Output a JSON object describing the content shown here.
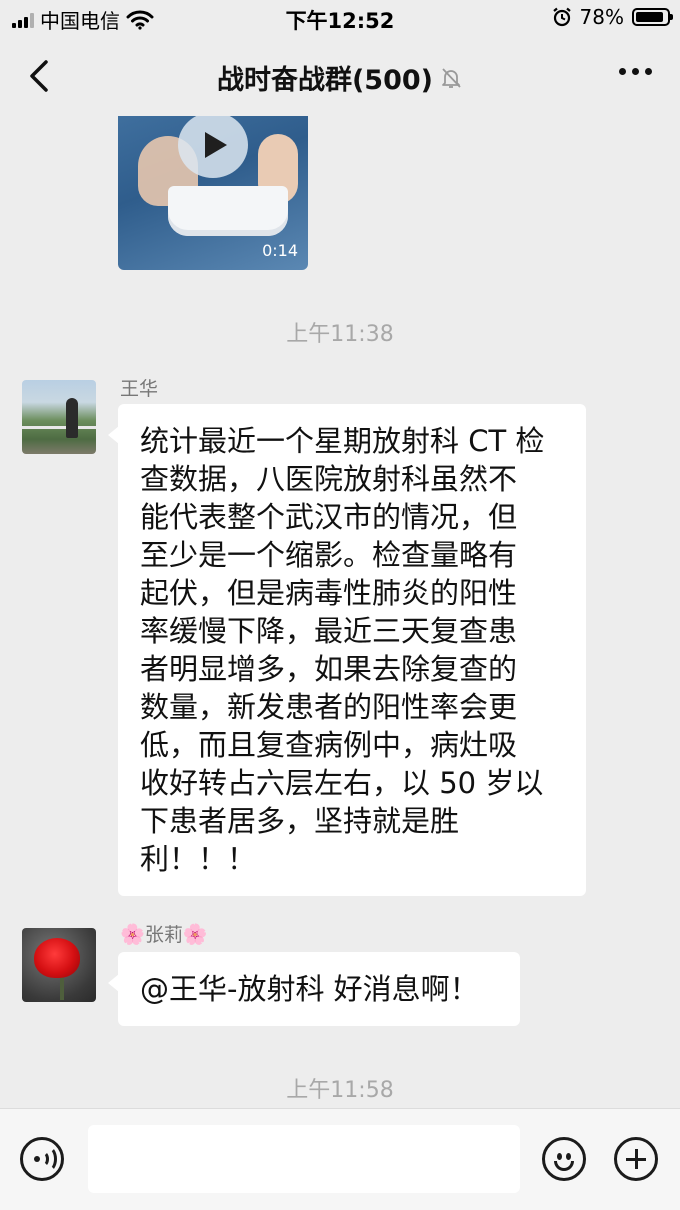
{
  "status_bar": {
    "carrier": "中国电信",
    "time": "下午12:52",
    "battery_percent": "78%",
    "icons": [
      "signal-icon",
      "wifi-icon",
      "alarm-icon",
      "battery-icon"
    ]
  },
  "nav": {
    "title": "战时奋战群(500)",
    "icons": [
      "back-icon",
      "mute-bell-icon",
      "more-icon"
    ]
  },
  "messages": {
    "video": {
      "duration": "0:14",
      "icon": "play-icon"
    },
    "time_1": "上午11:38",
    "msg_1": {
      "sender": "王华",
      "lines": [
        "统计最近一个星期放射科 CT 检",
        "查数据，八医院放射科虽然不",
        "能代表整个武汉市的情况，但",
        "至少是一个缩影。检查量略有",
        "起伏，但是病毒性肺炎的阳性",
        "率缓慢下降，最近三天复查患",
        "者明显增多，如果去除复查的",
        "数量，新发患者的阳性率会更",
        "低，而且复查病例中，病灶吸",
        "收好转占六层左右，以 50 岁以",
        "下患者居多，坚持就是胜",
        "利！！！"
      ]
    },
    "msg_2": {
      "sender_prefix": "🌸",
      "sender": "张莉",
      "sender_suffix": "🌸",
      "text": "@王华-放射科 好消息啊！"
    },
    "time_2": "上午11:58"
  },
  "input_bar": {
    "icons": [
      "voice-icon",
      "emoji-icon",
      "plus-icon"
    ],
    "text_value": ""
  },
  "colors": {
    "background": "#ededed",
    "bubble": "#ffffff",
    "timestamp": "#a8a8a8",
    "sender_name": "#777777"
  }
}
